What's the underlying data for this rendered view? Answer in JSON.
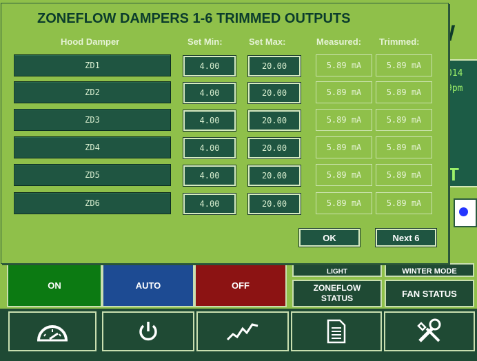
{
  "background": {
    "title_fragment": "W",
    "date_fragment": "014",
    "time_fragment": "9pm",
    "status_fragment": "T",
    "controls": {
      "on_label": "ON",
      "auto_label": "AUTO",
      "off_label": "OFF",
      "light_label": "LIGHT",
      "winter_mode_label": "WINTER MODE",
      "zoneflow_status_label": "ZONEFLOW\nSTATUS",
      "fan_status_label": "FAN STATUS"
    },
    "colors": {
      "on": "#0c7a12",
      "auto": "#1d4b93",
      "off": "#8c1313"
    },
    "nav_icons": [
      "gauge-icon",
      "power-icon",
      "trend-icon",
      "document-icon",
      "tools-icon"
    ]
  },
  "dialog": {
    "title": "ZONEFLOW DAMPERS 1-6 TRIMMED OUTPUTS",
    "columns": {
      "hood_damper": "Hood Damper",
      "set_min": "Set Min:",
      "set_max": "Set Max:",
      "measured": "Measured:",
      "trimmed": "Trimmed:"
    },
    "rows": [
      {
        "name": "ZD1",
        "min": "4.00",
        "max": "20.00",
        "measured": "5.89 mA",
        "trimmed": "5.89 mA"
      },
      {
        "name": "ZD2",
        "min": "4.00",
        "max": "20.00",
        "measured": "5.89 mA",
        "trimmed": "5.89 mA"
      },
      {
        "name": "ZD3",
        "min": "4.00",
        "max": "20.00",
        "measured": "5.89 mA",
        "trimmed": "5.89 mA"
      },
      {
        "name": "ZD4",
        "min": "4.00",
        "max": "20.00",
        "measured": "5.89 mA",
        "trimmed": "5.89 mA"
      },
      {
        "name": "ZD5",
        "min": "4.00",
        "max": "20.00",
        "measured": "5.89 mA",
        "trimmed": "5.89 mA"
      },
      {
        "name": "ZD6",
        "min": "4.00",
        "max": "20.00",
        "measured": "5.89 mA",
        "trimmed": "5.89 mA"
      }
    ],
    "ok_label": "OK",
    "next_label": "Next 6"
  }
}
